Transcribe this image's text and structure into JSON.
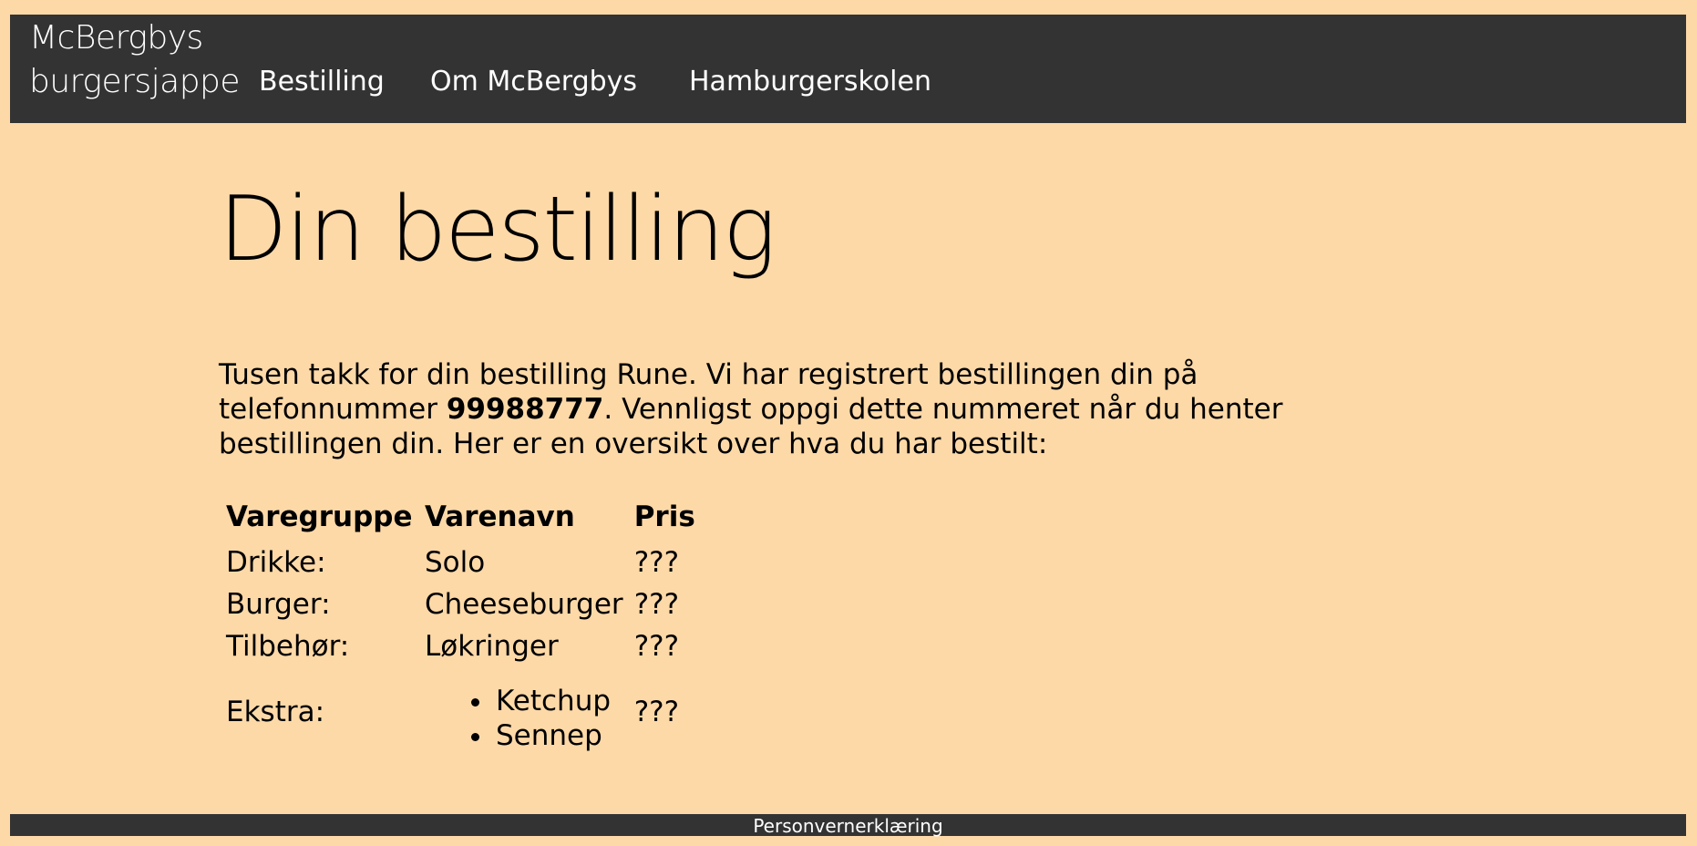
{
  "header": {
    "brand_line1": "McBergbys",
    "brand_line2": "burgersjappe",
    "nav": [
      {
        "label": "Bestilling"
      },
      {
        "label": "Om McBergbys"
      },
      {
        "label": "Hamburgerskolen"
      }
    ]
  },
  "main": {
    "title": "Din bestilling",
    "intro_part1": "Tusen takk for din bestilling Rune. Vi har registrert bestillingen din på telefonnummer ",
    "phone": "99988777",
    "intro_part2": ". Vennligst oppgi dette nummeret når du henter bestillingen din. Her er en oversikt over hva du har bestilt:",
    "table": {
      "headers": [
        "Varegruppe",
        "Varenavn",
        "Pris"
      ],
      "rows": [
        {
          "group": "Drikke:",
          "name": "Solo",
          "price": "???"
        },
        {
          "group": "Burger:",
          "name": "Cheeseburger",
          "price": "???"
        },
        {
          "group": "Tilbehør:",
          "name": "Løkringer",
          "price": "???"
        }
      ],
      "extras": {
        "group": "Ekstra:",
        "items": [
          "Ketchup",
          "Sennep"
        ],
        "price": "???"
      }
    }
  },
  "footer": {
    "link": "Personvernerklæring"
  }
}
